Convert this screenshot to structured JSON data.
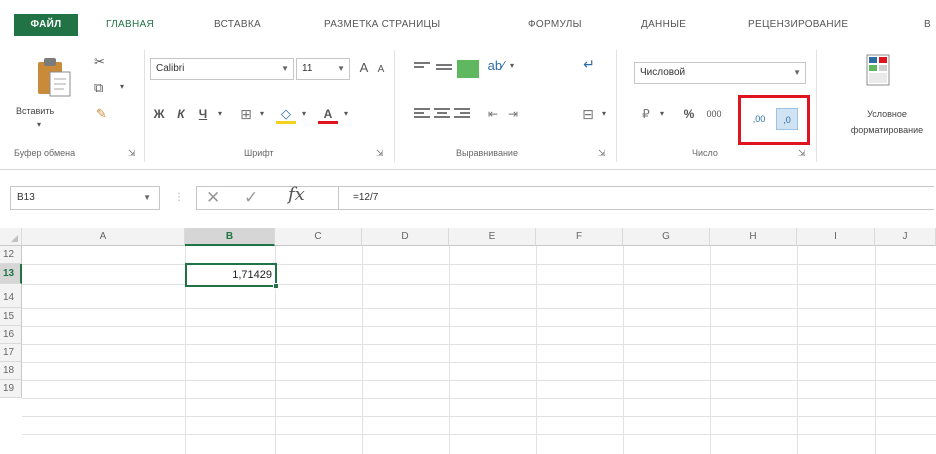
{
  "ribbon_tabs": [
    "ФАЙЛ",
    "ГЛАВНАЯ",
    "ВСТАВКА",
    "РАЗМЕТКА СТРАНИЦЫ",
    "ФОРМУЛЫ",
    "ДАННЫЕ",
    "РЕЦЕНЗИРОВАНИЕ",
    "В"
  ],
  "clipboard": {
    "paste_label": "Вставить",
    "group_label": "Буфер обмена"
  },
  "font": {
    "name": "Calibri",
    "size": "11",
    "grow": "A",
    "shrink": "A",
    "bold": "Ж",
    "italic": "К",
    "underline": "Ч",
    "group_label": "Шрифт"
  },
  "alignment": {
    "group_label": "Выравнивание"
  },
  "number": {
    "format": "Числовой",
    "percent": "%",
    "thousands": "000",
    "group_label": "Число",
    "increase_decimal": ",00",
    "decrease_decimal": ",0"
  },
  "styles": {
    "conditional_formatting_line1": "Условное",
    "conditional_formatting_line2": "форматирование"
  },
  "formula_bar": {
    "name_box": "B13",
    "formula": "=12/7",
    "fx": "fx"
  },
  "grid": {
    "columns": [
      "A",
      "B",
      "C",
      "D",
      "E",
      "F",
      "G",
      "H",
      "I",
      "J"
    ],
    "rows": [
      "12",
      "13",
      "14",
      "15",
      "16",
      "17",
      "18",
      "19"
    ],
    "selected_column": "B",
    "selected_row": "13",
    "active_value": "1,71429"
  },
  "colors": {
    "accent": "#217346",
    "highlight": "#e0141e"
  }
}
